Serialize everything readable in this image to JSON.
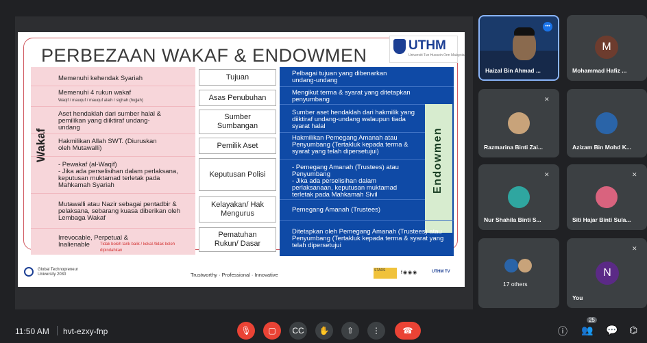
{
  "slide": {
    "title": "PERBEZAAN WAKAF & ENDOWMEN",
    "logo": "UTHM",
    "logo_sub": "Universiti Tun Hussein Onn Malaysia",
    "wakaf_label": "Wakaf",
    "endowmen_label": "Endowmen",
    "wakaf_rows": [
      {
        "text": "Memenuhi kehendak Syariah",
        "small": ""
      },
      {
        "text": "Memenuhi 4 rukun wakaf",
        "small": "Waqif / mauquf / mauquf alaih / sighah (hujjah)"
      },
      {
        "text": "Aset hendaklah dari sumber halal & pemilikan yang diiktiraf undang-undang",
        "small": ""
      },
      {
        "text": "Hakmilikan Allah SWT. (Diuruskan oleh Mutawalli)",
        "small": ""
      },
      {
        "text": "- Pewakaf (al-Waqif)\n- Jika ada perselisihan dalam perlaksana, keputusan muktamad terletak pada Mahkamah Syariah",
        "small": ""
      },
      {
        "text": "Mutawalli atau Nazir sebagai pentadbir & pelaksana, sebarang kuasa diberikan oleh Lembaga Wakaf",
        "small": ""
      },
      {
        "text": "Irrevocable, Perpetual & Inalienable",
        "small": "Tidak boleh tarik balik / kekal /tidak boleh dipindahkan"
      }
    ],
    "criteria": [
      "Tujuan",
      "Asas Penubuhan",
      "Sumber Sumbangan",
      "Pemilik Aset",
      "Keputusan Polisi",
      "Kelayakan/ Hak Mengurus",
      "Pematuhan Rukun/ Dasar"
    ],
    "endowmen_rows": [
      "Pelbagai tujuan yang dibenarkan undang-undang",
      "Mengikut terma & syarat yang ditetapkan penyumbang",
      "Sumber aset hendaklah dari hakmilik yang diiktiraf undang-undang walaupun tiada syarat halal",
      "Hakmilikan Pemegang Amanah atau Penyumbang (Tertakluk kepada terma & syarat yang telah dipersetujui)",
      "- Pemegang Amanah (Trustees) atau Penyumbang\n- Jika ada perselisihan dalam perlaksanaan, keputusan muktamad terletak pada Mahkamah Sivil",
      "Pemegang Amanah (Trustees)",
      "Ditetapkan oleh Pemegang Amanah (Trustees) atau Penyumbang (Tertakluk kepada terma & syarat yang telah dipersetujui"
    ],
    "footer": {
      "gt_line1": "Global Technopreneur",
      "gt_line2": "University 2030",
      "tagline": "Trustworthy · Professional · Innovative",
      "stars": "STARS",
      "social": "f◉◉◉",
      "tv": "UTHM TV"
    }
  },
  "participants": [
    {
      "name": "Haizal Bin Ahmad ...",
      "initial": "",
      "color": "#1a3a6a"
    },
    {
      "name": "Mohammad Hafiz ...",
      "initial": "M",
      "color": "#6d3c2e"
    },
    {
      "name": "Razmarina Binti Zai...",
      "initial": "",
      "color": "#3c4043"
    },
    {
      "name": "Azizam Bin Mohd K...",
      "initial": "",
      "color": "#3c4043"
    },
    {
      "name": "Nur Shahila Binti S...",
      "initial": "",
      "color": "#3c4043"
    },
    {
      "name": "Siti Hajar Binti Sula...",
      "initial": "",
      "color": "#3c4043"
    },
    {
      "name": "17 others",
      "initial": "",
      "color": "#3c4043"
    },
    {
      "name": "You",
      "initial": "N",
      "color": "#5b2a86"
    }
  ],
  "bottom": {
    "time": "11:50 AM",
    "meeting_code": "hvt-ezxy-fnp",
    "participant_count": "25"
  }
}
